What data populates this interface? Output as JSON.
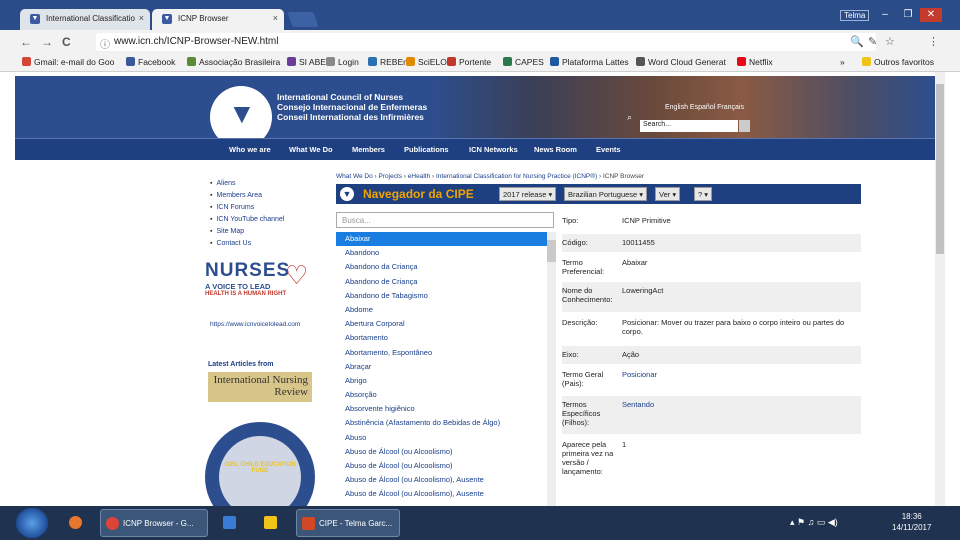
{
  "browser": {
    "tabs": [
      {
        "label": "International Classificatio",
        "close": "×"
      },
      {
        "label": "ICNP Browser",
        "close": "×"
      }
    ],
    "window_user": "Telma",
    "window_buttons": [
      "–",
      "❐",
      "✕"
    ],
    "nav_buttons": [
      "←",
      "→",
      "C"
    ],
    "url": "www.icn.ch/ICNP-Browser-NEW.html",
    "address_icons": [
      "🔍",
      "✎",
      "☆",
      "⋮"
    ],
    "bookmarks": [
      {
        "label": "Gmail: e-mail do Goo",
        "color": "#d44638"
      },
      {
        "label": "Facebook",
        "color": "#3b5998"
      },
      {
        "label": "Associação Brasileira",
        "color": "#5b8a3a"
      },
      {
        "label": "SI ABEn",
        "color": "#6a3d9a"
      },
      {
        "label": "Login",
        "color": "#888888"
      },
      {
        "label": "REBEn",
        "color": "#2a6fb0"
      },
      {
        "label": "SciELO",
        "color": "#e08a00"
      },
      {
        "label": "Portente",
        "color": "#c0392b"
      },
      {
        "label": "CAPES",
        "color": "#2c7a4b"
      },
      {
        "label": "Plataforma Lattes",
        "color": "#1f5aa0"
      },
      {
        "label": "Word Cloud Generat",
        "color": "#555555"
      },
      {
        "label": "Netflix",
        "color": "#e50914"
      },
      {
        "label": "»",
        "color": ""
      },
      {
        "label": "Outros favoritos",
        "color": "#f0c419"
      }
    ]
  },
  "site": {
    "org_lines": [
      "International Council of Nurses",
      "Consejo Internacional de Enfermeras",
      "Conseil International des Infirmières"
    ],
    "languages": "English  Español  Français",
    "search_placeholder": "Search...",
    "menu": [
      "Who we are",
      "What We Do",
      "Members",
      "Publications",
      "ICN Networks",
      "News Room",
      "Events"
    ],
    "sidebar_links": [
      "Aliens",
      "Members Area",
      "ICN Forums",
      "ICN YouTube channel",
      "Site Map",
      "Contact Us"
    ],
    "nurses_campaign": {
      "title": "NURSES",
      "sub": "A VOICE TO LEAD",
      "tag": "HEALTH IS A HUMAN RIGHT",
      "url": "https://www.icnvoicetolead.com"
    },
    "latest_articles": "Latest Articles from",
    "inr_logo": "International Nursing Review",
    "fund_badge": "GIRL CHILD EDUCATION FUND"
  },
  "breadcrumb": [
    "What We Do",
    "Projects",
    "eHealth",
    "International Classification for Nursing Practice (ICNP®)",
    "ICNP Browser"
  ],
  "cipe": {
    "title": "Navegador da CIPE",
    "release": "2017 release ▾",
    "language": "Brazilian Portuguese ▾",
    "view": "Ver ▾",
    "help": "? ▾",
    "list_placeholder": "Busca...",
    "list": [
      "Abaixar",
      "Abandono",
      "Abandono da Criança",
      "Abandono de Criança",
      "Abandono de Tabagismo",
      "Abdome",
      "Abertura Corporal",
      "Abortamento",
      "Abortamento, Espontâneo",
      "Abraçar",
      "Abrigo",
      "Absorção",
      "Absorvente higiênico",
      "Abstinência (Afastamento do Bebidas de Álgo)",
      "Abuso",
      "Abuso de Álcool (ou Alcoolismo)",
      "Abuso de Álcool (ou Alcoolismo)",
      "Abuso de Álcool (ou Alcoolismo), Ausente",
      "Abuso de Álcool (ou Alcoolismo), Ausente"
    ],
    "details": [
      {
        "label": "Tipo:",
        "value": "ICNP Primitive",
        "link": false
      },
      {
        "label": "Código:",
        "value": "10011455",
        "link": false
      },
      {
        "label": "Termo Preferencial:",
        "value": "Abaixar",
        "link": false
      },
      {
        "label": "Nome do Conhecimento:",
        "value": "LoweringAct",
        "link": false
      },
      {
        "label": "Descrição:",
        "value": "Posicionar: Mover ou trazer para baixo o corpo inteiro ou partes do corpo.",
        "link": false
      },
      {
        "label": "Eixo:",
        "value": "Ação",
        "link": false
      },
      {
        "label": "Termo Geral (Pais):",
        "value": "Posicionar",
        "link": true
      },
      {
        "label": "Termos Específicos (Filhos):",
        "value": "Sentando",
        "link": true
      },
      {
        "label": "Aparece pela primeira vez na versão / lançamento:",
        "value": "1",
        "link": false
      }
    ]
  },
  "taskbar": {
    "apps": [
      {
        "label": "",
        "color": "#e8772e"
      },
      {
        "label": "ICNP Browser - G...",
        "color": "#db4437"
      },
      {
        "label": "",
        "color": "#3a7bd5"
      },
      {
        "label": "",
        "color": "#f0c419"
      },
      {
        "label": "CIPE - Telma Garc...",
        "color": "#d24726"
      }
    ],
    "tray": "▴ ⚑ ♫ ▭ ◀)",
    "time": "18:36",
    "date": "14/11/2017"
  }
}
